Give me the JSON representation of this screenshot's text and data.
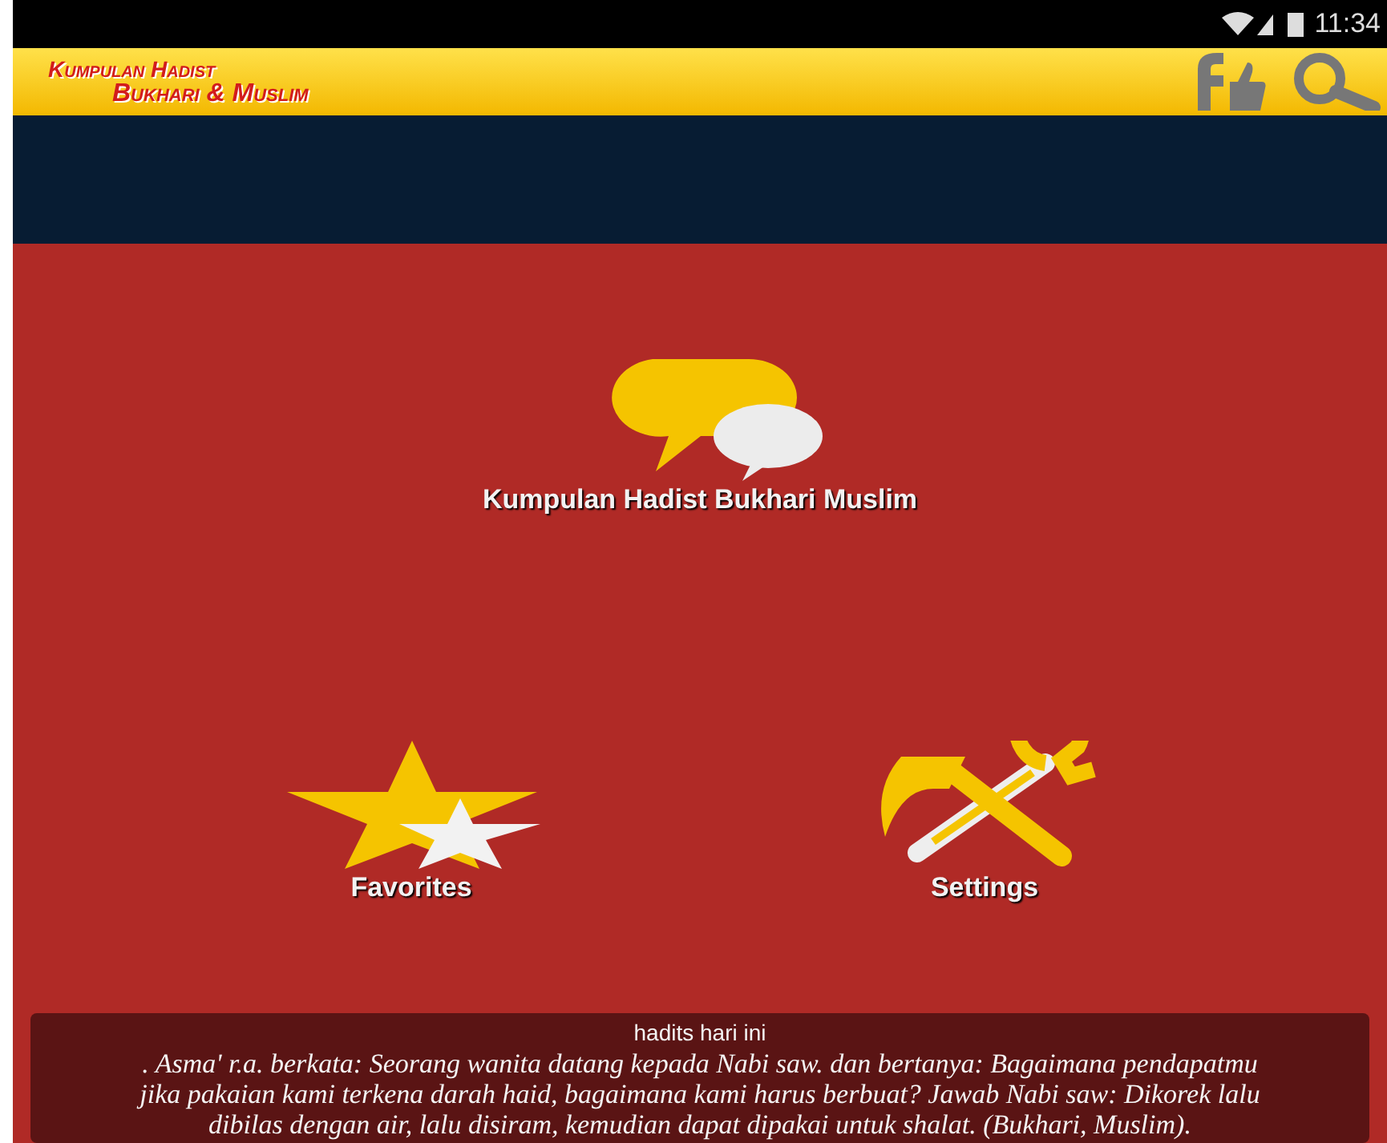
{
  "status_bar": {
    "time": "11:34"
  },
  "app_bar": {
    "title_line_1": "Kumpulan Hadist",
    "title_line_2": "Bukhari & Muslim"
  },
  "menu": [
    {
      "kind": "chat",
      "label": "Kumpulan Hadist Bukhari Muslim"
    },
    {
      "kind": "star",
      "label": "Favorites"
    },
    {
      "kind": "tools",
      "label": "Settings"
    }
  ],
  "daily_hadith": {
    "title": "hadits hari ini",
    "text": ". Asma' r.a. berkata: Seorang wanita datang kepada Nabi saw. dan bertanya: Bagaimana pendapatmu jika pakaian kami terkena darah haid, bagaimana kami harus berbuat? Jawab Nabi saw: Dikorek lalu dibilas dengan air, lalu disiram, kemudian dapat dipakai untuk shalat. (Bukhari, Muslim)."
  }
}
